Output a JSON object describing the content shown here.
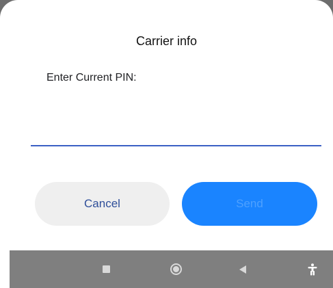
{
  "dialog": {
    "title": "Carrier info",
    "message": "Enter Current PIN:",
    "pin_value": "",
    "cancel_label": "Cancel",
    "send_label": "Send"
  },
  "navigation_bar": {
    "recents_icon": "square-icon",
    "home_icon": "circle-icon",
    "back_icon": "triangle-back-icon",
    "accessibility_icon": "accessibility-person-icon"
  },
  "colors": {
    "send_button": "#1a84ff",
    "cancel_button": "#efefef",
    "input_underline": "#3b5fc4",
    "navbar": "#7f7f7f"
  }
}
